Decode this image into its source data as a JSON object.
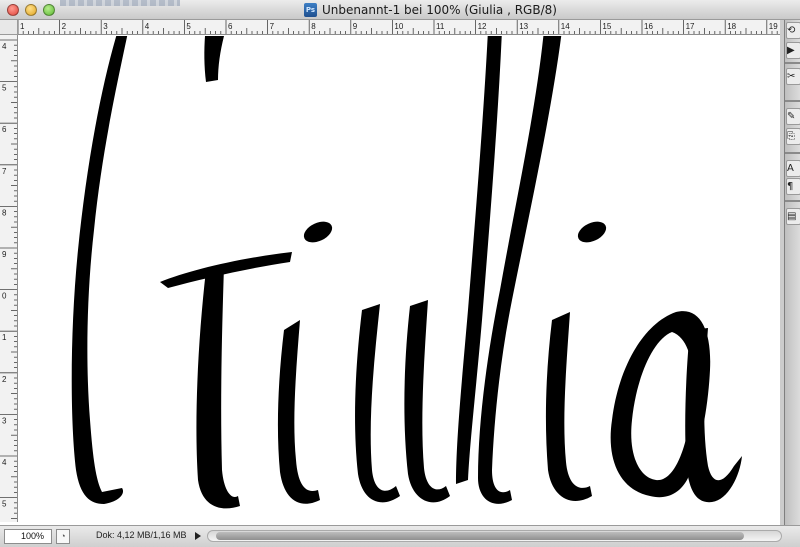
{
  "window": {
    "title": "Unbenannt-1 bei 100% (Giulia , RGB/8)",
    "app_icon_label": "Ps"
  },
  "rulers": {
    "horizontal_ticks": [
      "1",
      "2",
      "3",
      "4",
      "5",
      "6",
      "7",
      "8",
      "9",
      "10",
      "11",
      "12",
      "13",
      "14",
      "15",
      "16",
      "17",
      "18",
      "19"
    ],
    "vertical_ticks": [
      "4",
      "5",
      "6",
      "7",
      "8",
      "9",
      "0",
      "1",
      "2",
      "3",
      "4",
      "5"
    ]
  },
  "canvas": {
    "layer_name": "Giulia",
    "ink_color": "#000000",
    "background_color": "#ffffff"
  },
  "statusbar": {
    "zoom": "100%",
    "doc_info": "Dok: 4,12 MB/1,16 MB"
  },
  "panel_tools": [
    {
      "name": "history-icon",
      "glyph": "⟲"
    },
    {
      "name": "actions-icon",
      "glyph": "▶"
    },
    {
      "name": "tools-preset-icon",
      "glyph": "✂"
    },
    {
      "name": "brushes-icon",
      "glyph": "✎"
    },
    {
      "name": "clone-source-icon",
      "glyph": "⎘"
    },
    {
      "name": "character-icon",
      "glyph": "A"
    },
    {
      "name": "paragraph-icon",
      "glyph": "¶"
    },
    {
      "name": "layer-comps-icon",
      "glyph": "▤"
    }
  ]
}
